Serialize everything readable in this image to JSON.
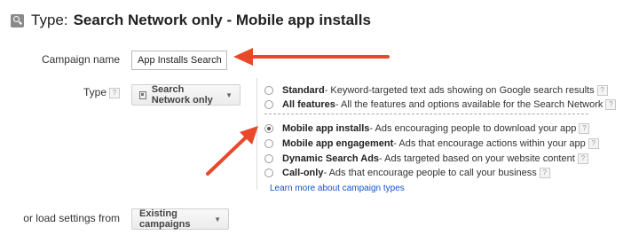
{
  "header": {
    "prefix": "Type:",
    "title": "Search Network only - Mobile app installs",
    "icon": "magnifier-icon"
  },
  "campaign_name": {
    "label": "Campaign name",
    "value": "App Installs Search"
  },
  "type": {
    "label": "Type",
    "help": "?",
    "dropdown_label": "Search Network only",
    "options_group1": [
      {
        "title": "Standard",
        "desc": " - Keyword-targeted text ads showing on Google search results",
        "selected": false
      },
      {
        "title": "All features",
        "desc": " - All the features and options available for the Search Network",
        "selected": false
      }
    ],
    "options_group2": [
      {
        "title": "Mobile app installs",
        "desc": " - Ads encouraging people to download your app",
        "selected": true
      },
      {
        "title": "Mobile app engagement",
        "desc": " - Ads that encourage actions within your app",
        "selected": false
      },
      {
        "title": "Dynamic Search Ads",
        "desc": " - Ads targeted based on your website content",
        "selected": false
      },
      {
        "title": "Call-only",
        "desc": " - Ads that encourage people to call your business",
        "selected": false
      }
    ],
    "learn_more": "Learn more about campaign types"
  },
  "load_settings": {
    "label": "or load settings from",
    "dropdown_label": "Existing campaigns"
  },
  "colors": {
    "annotation_arrow": "#e8492b",
    "link": "#1155cc"
  }
}
